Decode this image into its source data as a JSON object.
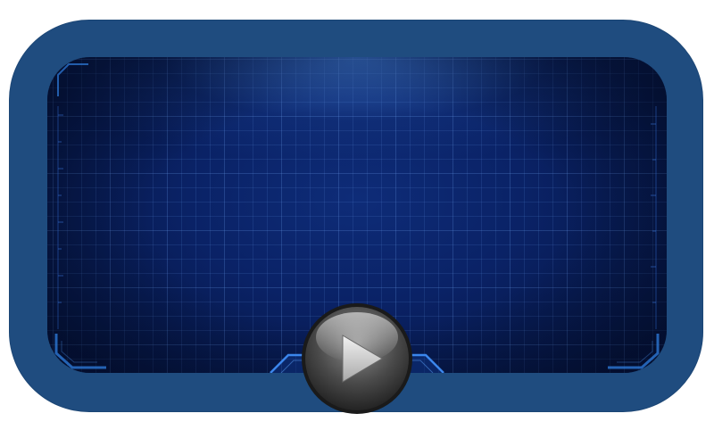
{
  "player": {
    "frame_color": "#1f4c7f",
    "screen_color": "#0a2266",
    "grid_color": "#4f8cdc",
    "accent_color": "#2f7fe0"
  },
  "controls": {
    "play_icon": "play-icon"
  }
}
